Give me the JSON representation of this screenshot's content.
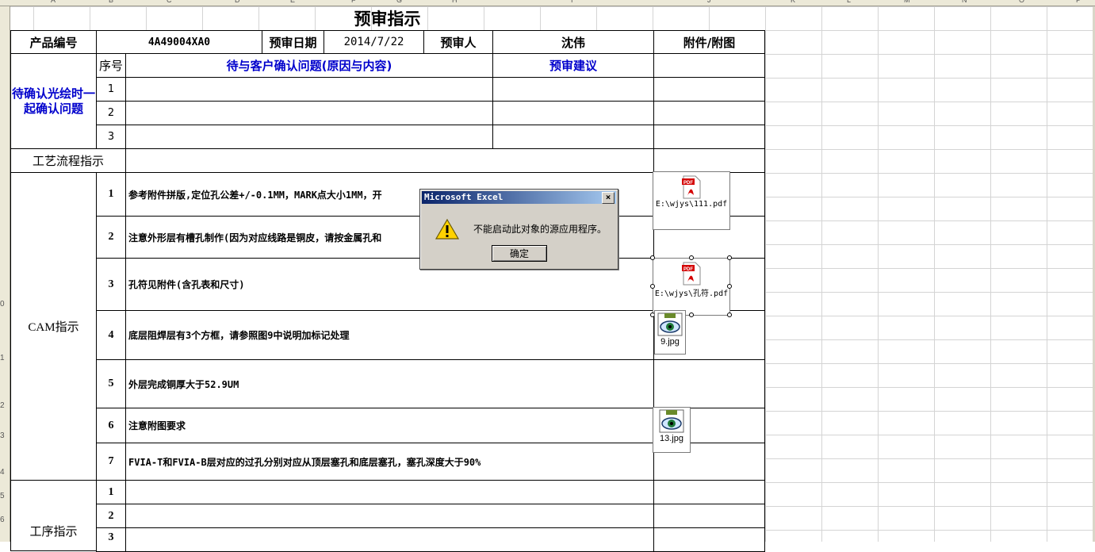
{
  "column_headers": [
    "A",
    "B",
    "C",
    "D",
    "E",
    "F",
    "G",
    "H",
    "I",
    "J",
    "K",
    "L",
    "M",
    "N",
    "O",
    "P"
  ],
  "row_headers": [
    "0",
    "1",
    "2",
    "3",
    "4",
    "5",
    "6"
  ],
  "sheet": {
    "title": "预审指示",
    "header_row": {
      "product_no_label": "产品编号",
      "product_no_value": "4A49004XA0",
      "date_label": "预审日期",
      "date_value": "2014/7/22",
      "reviewer_label": "预审人",
      "reviewer_value": "沈伟",
      "attachment_label": "附件/附图"
    },
    "confirm_section": {
      "label": "待确认光绘时一起确认问题",
      "seq_header": "序号",
      "issue_header": "待与客户确认问题(原因与内容)",
      "suggestion_header": "预审建议",
      "rows": [
        "1",
        "2",
        "3"
      ]
    },
    "process_label": "工艺流程指示",
    "cam_section": {
      "label": "CAM指示",
      "rows": [
        {
          "no": "1",
          "text": "参考附件拼版,定位孔公差+/-0.1MM，MARK点大小1MM，开"
        },
        {
          "no": "2",
          "text": "注意外形层有槽孔制作(因为对应线路是铜皮，请按金属孔和"
        },
        {
          "no": "3",
          "text": "孔符见附件(含孔表和尺寸)"
        },
        {
          "no": "4",
          "text": "底层阻焊层有3个方框，请参照图9中说明加标记处理"
        },
        {
          "no": "5",
          "text": "外层完成铜厚大于52.9UM"
        },
        {
          "no": "6",
          "text": "注意附图要求"
        },
        {
          "no": "7",
          "text": "FVIA-T和FVIA-B层对应的过孔分别对应从顶层塞孔和底层塞孔，塞孔深度大于90%"
        }
      ]
    },
    "operation_section": {
      "label": "工序指示",
      "rows": [
        "1",
        "2",
        "3"
      ]
    },
    "attachments": [
      {
        "label": "E:\\wjys\\111.pdf",
        "icon": "pdf-icon"
      },
      {
        "label": "E:\\wjys\\孔符.pdf",
        "icon": "pdf-icon"
      },
      {
        "label": "9.jpg",
        "icon": "image-icon"
      },
      {
        "label": "13.jpg",
        "icon": "image-icon"
      }
    ]
  },
  "dialog": {
    "title": "Microsoft Excel",
    "close": "×",
    "message": "不能启动此对象的源应用程序。",
    "ok_label": "确定"
  }
}
